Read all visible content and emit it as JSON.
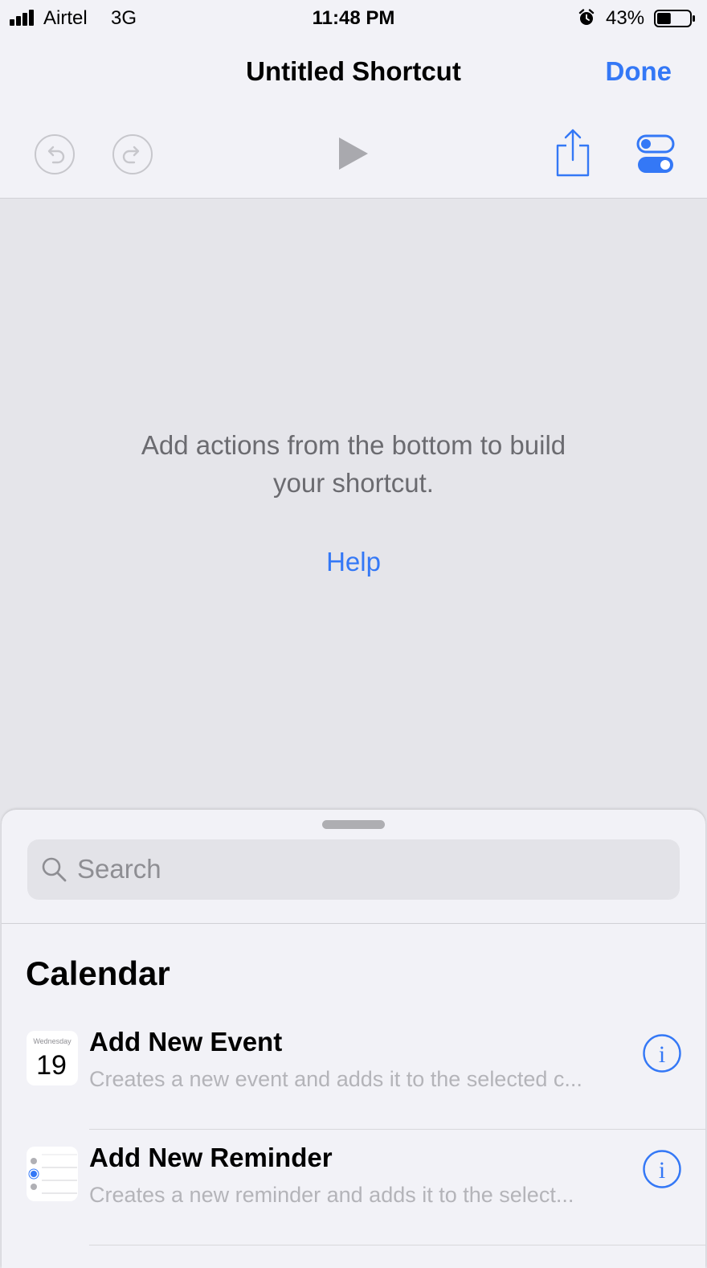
{
  "status_bar": {
    "carrier": "Airtel",
    "network": "3G",
    "time": "11:48 PM",
    "battery": "43%",
    "battery_level": 0.43
  },
  "nav": {
    "title": "Untitled Shortcut",
    "done_label": "Done"
  },
  "toolbar": {
    "icons": [
      "undo-icon",
      "redo-icon",
      "play-icon",
      "share-icon",
      "settings-toggle-icon"
    ]
  },
  "empty_state": {
    "message": "Add actions from the bottom to build your shortcut.",
    "help_label": "Help"
  },
  "actions_sheet": {
    "search_placeholder": "Search",
    "section_title": "Calendar",
    "items": [
      {
        "title": "Add New Event",
        "subtitle": "Creates a new event and adds it to the selected c...",
        "icon": "calendar-icon",
        "icon_text_day": "Wednesday",
        "icon_text_date": "19"
      },
      {
        "title": "Add New Reminder",
        "subtitle": "Creates a new reminder and adds it to the select...",
        "icon": "reminders-icon"
      }
    ]
  },
  "colors": {
    "accent": "#3478f6",
    "background": "#e5e5ea",
    "bar_background": "#f2f2f7"
  }
}
